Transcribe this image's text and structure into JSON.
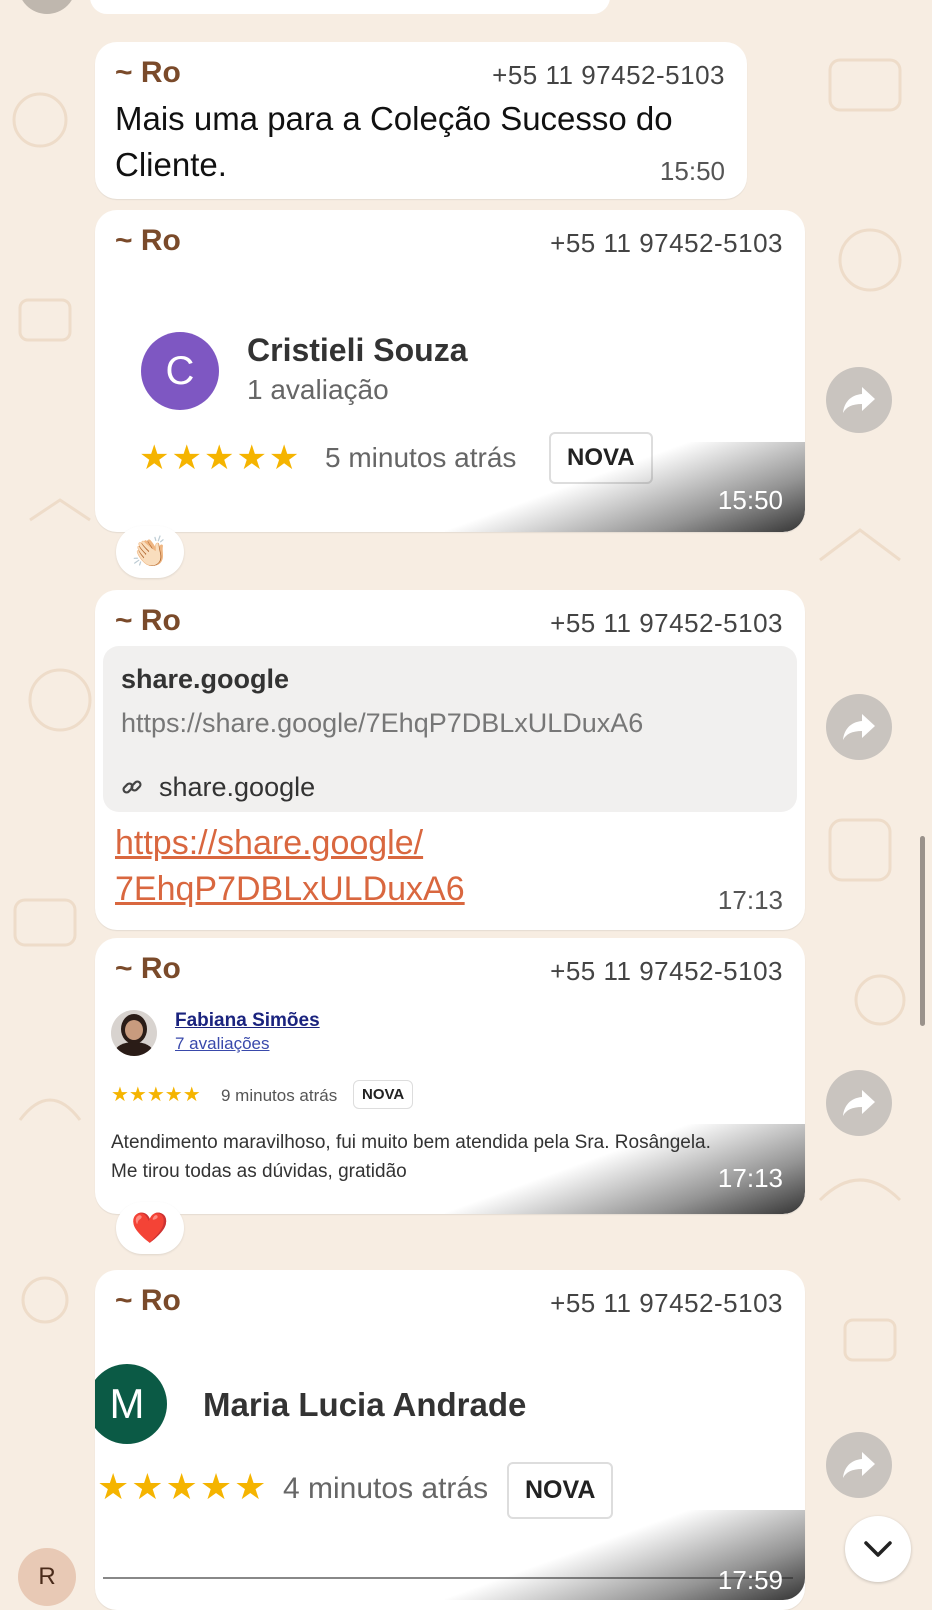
{
  "messages": [
    {
      "sender": "~ Ro",
      "phone": "+55 11 97452-5103",
      "text": "Mais uma para a Coleção Sucesso do Cliente.",
      "time": "15:50"
    },
    {
      "sender": "~ Ro",
      "phone": "+55 11 97452-5103",
      "time": "15:50",
      "review": {
        "avatar_letter": "C",
        "name": "Cristieli Souza",
        "count": "1 avaliação",
        "stars": "★★★★★",
        "when": "5 minutos atrás",
        "badge": "NOVA"
      },
      "reaction": "👏🏻"
    },
    {
      "sender": "~ Ro",
      "phone": "+55 11 97452-5103",
      "time": "17:13",
      "preview": {
        "title": "share.google",
        "url": "https://share.google/7EhqP7DBLxULDuxA6",
        "domain": "share.google"
      },
      "link_line1": "https://share.google/",
      "link_line2": "7EhqP7DBLxULDuxA6"
    },
    {
      "sender": "~ Ro",
      "phone": "+55 11 97452-5103",
      "time": "17:13",
      "review": {
        "name": "Fabiana Simões",
        "count": "7 avaliações",
        "stars": "★★★★★",
        "when": "9 minutos atrás",
        "badge": "NOVA",
        "text_line1": "Atendimento maravilhoso, fui muito bem atendida pela Sra. Rosângela.",
        "text_line2": "Me tirou todas as dúvidas, gratidão"
      },
      "reaction": "❤️"
    },
    {
      "sender": "~ Ro",
      "phone": "+55 11 97452-5103",
      "time": "17:59",
      "review": {
        "avatar_letter": "M",
        "name": "Maria Lucia Andrade",
        "stars": "★★★★★",
        "when": "4 minutos atrás",
        "badge": "NOVA"
      }
    }
  ],
  "user_avatar_letter": "R",
  "colors": {
    "background": "#f7ede2",
    "sender": "#7a4a2a",
    "link": "#d9673f",
    "star": "#f5b400",
    "avatar_c": "#7e57c2",
    "avatar_m": "#0b5a45"
  }
}
